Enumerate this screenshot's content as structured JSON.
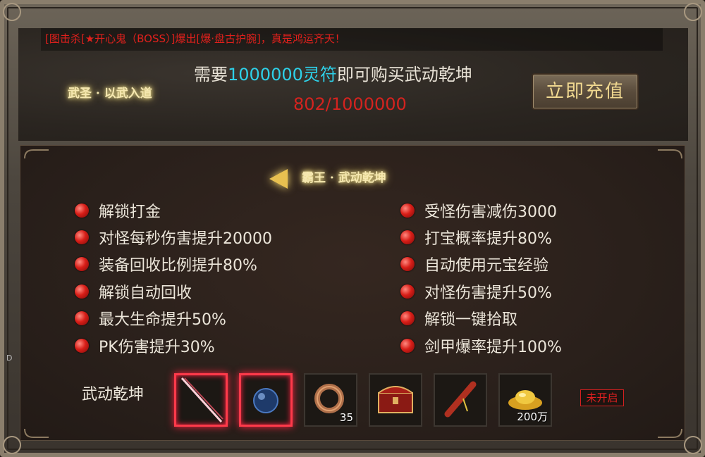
{
  "marquee": "[图击杀[★开心鬼（BOSS）]爆出[爆·盘古护腕]，真是鸿运齐天！",
  "header": {
    "need_prefix": "需要",
    "need_amount": "1000000灵符",
    "need_suffix": "即可购买武动乾坤",
    "progress": "802/1000000",
    "left_title": "武圣 · 以武入道",
    "recharge_label": "立即充值"
  },
  "section": {
    "title": "霸王 · 武动乾坤"
  },
  "attributes": {
    "left": [
      "解锁打金",
      "对怪每秒伤害提升20000",
      "装备回收比例提升80%",
      "解锁自动回收",
      "最大生命提升50%",
      "PK伤害提升30%"
    ],
    "right": [
      "受怪伤害减伤3000",
      "打宝概率提升80%",
      "自动使用元宝经验",
      "对怪伤害提升50%",
      "解锁一键拾取",
      "剑甲爆率提升100%"
    ]
  },
  "items": {
    "label": "武动乾坤",
    "slots": [
      {
        "icon": "sword-icon",
        "count": ""
      },
      {
        "icon": "blue-orb-icon",
        "count": ""
      },
      {
        "icon": "ring-icon",
        "count": "35"
      },
      {
        "icon": "treasure-chest-icon",
        "count": ""
      },
      {
        "icon": "scroll-icon",
        "count": ""
      },
      {
        "icon": "gold-ingot-icon",
        "count": "200万"
      }
    ],
    "status": "未开启"
  },
  "side_letter": "D",
  "colors": {
    "accent_cyan": "#2ed0e8",
    "progress_red": "#d4231f",
    "title_gold": "#f6e8b0",
    "bullet_red": "#d81e18"
  }
}
